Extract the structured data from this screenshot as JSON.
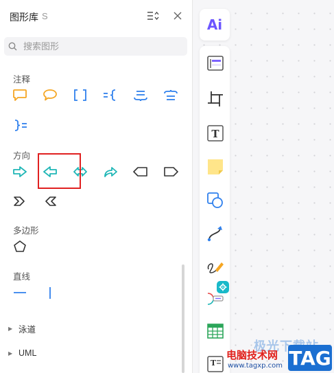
{
  "panel": {
    "title": "图形库",
    "shortcut": "S",
    "search_placeholder": "搜索图形"
  },
  "sections": {
    "annotation": "注释",
    "direction": "方向",
    "polygon": "多边形",
    "line": "直线"
  },
  "groups": {
    "swimlane": "泳道",
    "uml": "UML"
  },
  "colors": {
    "annotation": "#f5a623",
    "bracket": "#2f80ed",
    "arrow": "#1fb6b6",
    "outline": "#333333",
    "highlight": "#e02020",
    "ai": "#6b55ff"
  },
  "toolbar": {
    "ai_label": "Ai",
    "tools": [
      "template-icon",
      "frame-icon",
      "text-icon",
      "sticky-note-icon",
      "shape-icon",
      "connector-icon",
      "pen-icon",
      "mindmap-icon",
      "table-icon",
      "doc-icon"
    ]
  },
  "watermark": {
    "top": "极光下载站",
    "site": "电脑技术网",
    "url": "www.tagxp.com",
    "tag": "TAG"
  }
}
